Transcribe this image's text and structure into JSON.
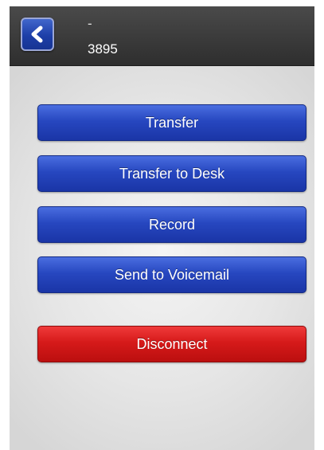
{
  "header": {
    "caller_name": "-",
    "caller_number": "3895",
    "back_icon": "chevron-left-icon"
  },
  "actions": {
    "transfer_label": "Transfer",
    "transfer_to_desk_label": "Transfer to Desk",
    "record_label": "Record",
    "send_to_voicemail_label": "Send to Voicemail",
    "disconnect_label": "Disconnect"
  },
  "colors": {
    "action_blue": "#2747c0",
    "disconnect_red": "#d61a1a",
    "header_dark": "#3a3a3a"
  }
}
